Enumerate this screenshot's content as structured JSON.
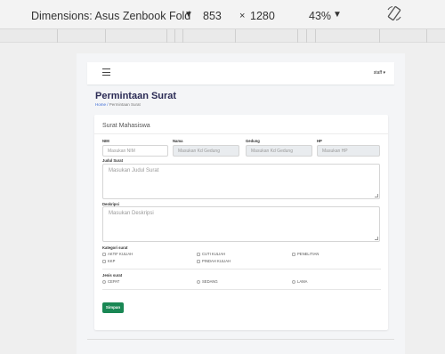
{
  "devtools": {
    "dimensions_label": "Dimensions: Asus Zenbook Fold",
    "width": "853",
    "times": "×",
    "height": "1280",
    "zoom": "43%",
    "icons": {
      "dropdown": "caret-down-icon",
      "rotate": "rotate-icon"
    }
  },
  "app": {
    "user_menu": "staff ▾",
    "icons": {
      "menu": "hamburger-icon"
    }
  },
  "page": {
    "title": "Permintaan Surat",
    "breadcrumb_home": "Home",
    "breadcrumb_sep": " / ",
    "breadcrumb_current": "Permintaan Surat"
  },
  "form": {
    "card_title": "Surat Mahasiswa",
    "nim_label": "NIM",
    "nim_placeholder": "Masukan NIM",
    "nama_label": "Nama",
    "nama_placeholder": "Masukan Kd Gedung",
    "gedung_label": "Gedung",
    "gedung_placeholder": "Masukan Kd Gedung",
    "hp_label": "HP",
    "hp_placeholder": "Masukan HP",
    "judul_label": "Judul Surat",
    "judul_placeholder": "Masukan Judul Surat",
    "deskripsi_label": "Deskripsi",
    "deskripsi_placeholder": "Masukan Deskripsi",
    "kategori_label": "Kategori surat",
    "kategori_options": [
      "AKTIF KULIAH",
      "CUTI KULIAH",
      "PENELITIAN",
      "KKP",
      "PINDAH KULIAH"
    ],
    "jenis_label": "Jenis surat",
    "jenis_options": [
      "CEPAT",
      "SEDANG",
      "LAMA"
    ],
    "submit_label": "Simpan"
  },
  "colors": {
    "primary_button": "#198754",
    "title": "#2b2b55",
    "link": "#3b6bd6"
  }
}
